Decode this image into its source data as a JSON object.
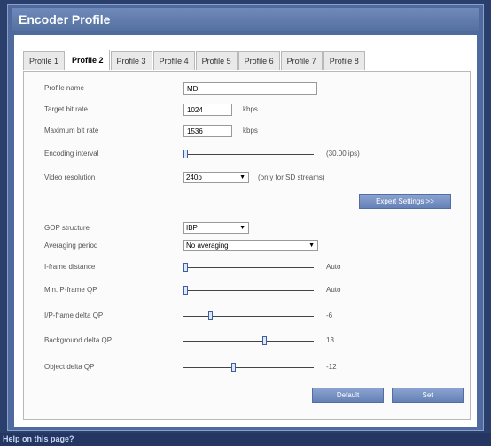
{
  "title": "Encoder Profile",
  "tabs": [
    "Profile 1",
    "Profile 2",
    "Profile 3",
    "Profile 4",
    "Profile 5",
    "Profile 6",
    "Profile 7",
    "Profile 8"
  ],
  "active_tab": "Profile 2",
  "fields": {
    "profile_name": {
      "label": "Profile name",
      "value": "MD"
    },
    "target_bit_rate": {
      "label": "Target bit rate",
      "value": "1024",
      "unit": "kbps"
    },
    "max_bit_rate": {
      "label": "Maximum bit rate",
      "value": "1536",
      "unit": "kbps"
    },
    "encoding_interval": {
      "label": "Encoding interval",
      "value_text": "(30.00 ips)",
      "position": 0
    },
    "video_resolution": {
      "label": "Video resolution",
      "value": "240p",
      "note": "(only for SD streams)"
    },
    "gop_structure": {
      "label": "GOP structure",
      "value": "IBP"
    },
    "averaging_period": {
      "label": "Averaging period",
      "value": "No averaging"
    },
    "i_frame_distance": {
      "label": "I-frame distance",
      "value_text": "Auto",
      "position": 0
    },
    "min_p_frame_qp": {
      "label": "Min. P-frame QP",
      "value_text": "Auto",
      "position": 0
    },
    "ip_frame_delta_qp": {
      "label": "I/P-frame delta QP",
      "value_text": "-6",
      "position": 0.2
    },
    "background_delta_qp": {
      "label": "Background delta QP",
      "value_text": "13",
      "position": 0.63
    },
    "object_delta_qp": {
      "label": "Object delta QP",
      "value_text": "-12",
      "position": 0.38
    }
  },
  "buttons": {
    "expert_settings": "Expert Settings >>",
    "default": "Default",
    "set": "Set"
  },
  "help_link": "Help on this page?",
  "colors": {
    "accent": "#4f6a9f",
    "button": "#7590c3",
    "slider_thumb": "#dfe8f6"
  }
}
